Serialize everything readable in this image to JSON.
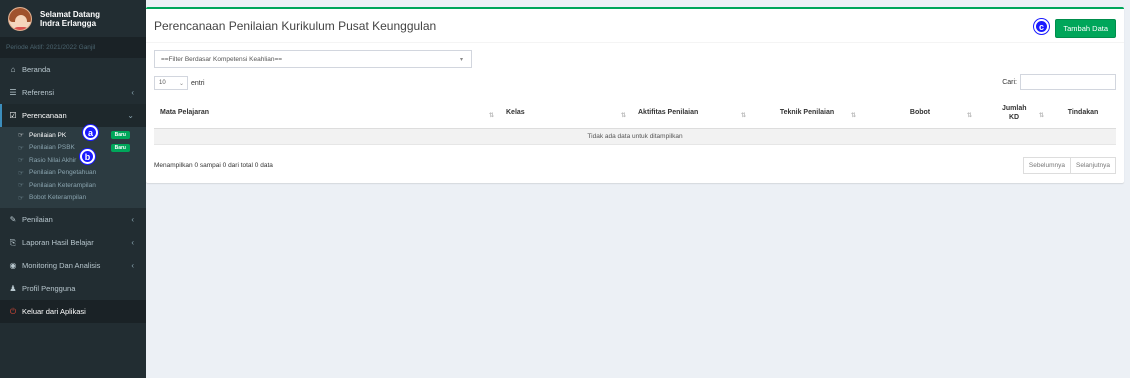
{
  "user": {
    "greeting": "Selamat Datang",
    "name": "Indra Erlangga"
  },
  "periode": "Periode Aktif: 2021/2022 Ganjil",
  "sidebar": {
    "items": [
      {
        "label": "Beranda",
        "icon": "⌂"
      },
      {
        "label": "Referensi",
        "icon": "☰",
        "chevron": "‹"
      },
      {
        "label": "Perencanaan",
        "icon": "☑",
        "chevron": "⌄"
      },
      {
        "label": "Penilaian",
        "icon": "✎",
        "chevron": "‹"
      },
      {
        "label": "Laporan Hasil Belajar",
        "icon": "⎘",
        "chevron": "‹"
      },
      {
        "label": "Monitoring Dan Analisis",
        "icon": "◉",
        "chevron": "‹"
      },
      {
        "label": "Profil Pengguna",
        "icon": "♟"
      },
      {
        "label": "Keluar dari Aplikasi",
        "icon": "⏻"
      }
    ],
    "submenu": [
      {
        "label": "Penilaian PK",
        "badge": "Baru"
      },
      {
        "label": "Penilaian PSBK",
        "badge": "Baru"
      },
      {
        "label": "Rasio Nilai Akhir"
      },
      {
        "label": "Penilaian Pengetahuan"
      },
      {
        "label": "Penilaian Keterampilan"
      },
      {
        "label": "Bobot Keterampilan"
      }
    ],
    "sub_icon": "☞"
  },
  "markers": {
    "a": "a",
    "b": "b",
    "c": "c"
  },
  "page": {
    "title": "Perencanaan Penilaian Kurikulum Pusat Keunggulan",
    "add_button": "Tambah Data",
    "filter_placeholder": "==Filter Berdasar Kompetensi Keahlian==",
    "length_value": "10",
    "length_label": "entri",
    "search_label": "Cari:",
    "table": {
      "headers": [
        "Mata Pelajaran",
        "Kelas",
        "Aktifitas Penilaian",
        "Teknik Penilaian",
        "Bobot",
        "Jumlah KD",
        "Tindakan"
      ],
      "empty": "Tidak ada data untuk ditampilkan"
    },
    "info": "Menampilkan 0 sampai 0 dari total 0 data",
    "prev": "Sebelumnya",
    "next": "Selanjutnya"
  },
  "colors": {
    "accent": "#00a65a",
    "sidebar": "#222d32",
    "marker": "#1a1aff"
  }
}
